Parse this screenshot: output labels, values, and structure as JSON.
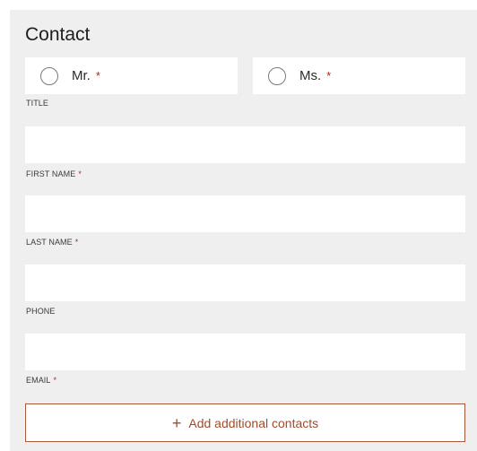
{
  "section": {
    "title": "Contact"
  },
  "title_options": {
    "label": "TITLE",
    "options": [
      {
        "label": "Mr.",
        "required_mark": "*"
      },
      {
        "label": "Ms.",
        "required_mark": "*"
      }
    ]
  },
  "fields": [
    {
      "label": "FIRST NAME",
      "required_mark": "*",
      "value": ""
    },
    {
      "label": "LAST NAME",
      "required_mark": "*",
      "value": ""
    },
    {
      "label": "PHONE",
      "value": ""
    },
    {
      "label": "EMAIL",
      "required_mark": "*",
      "value": ""
    }
  ],
  "add_contacts": {
    "icon": "plus-icon",
    "icon_glyph": "+",
    "label": "Add additional contacts"
  },
  "colors": {
    "accent": "#a14b2c",
    "required": "#b3261e",
    "panel_background": "#efefef"
  }
}
